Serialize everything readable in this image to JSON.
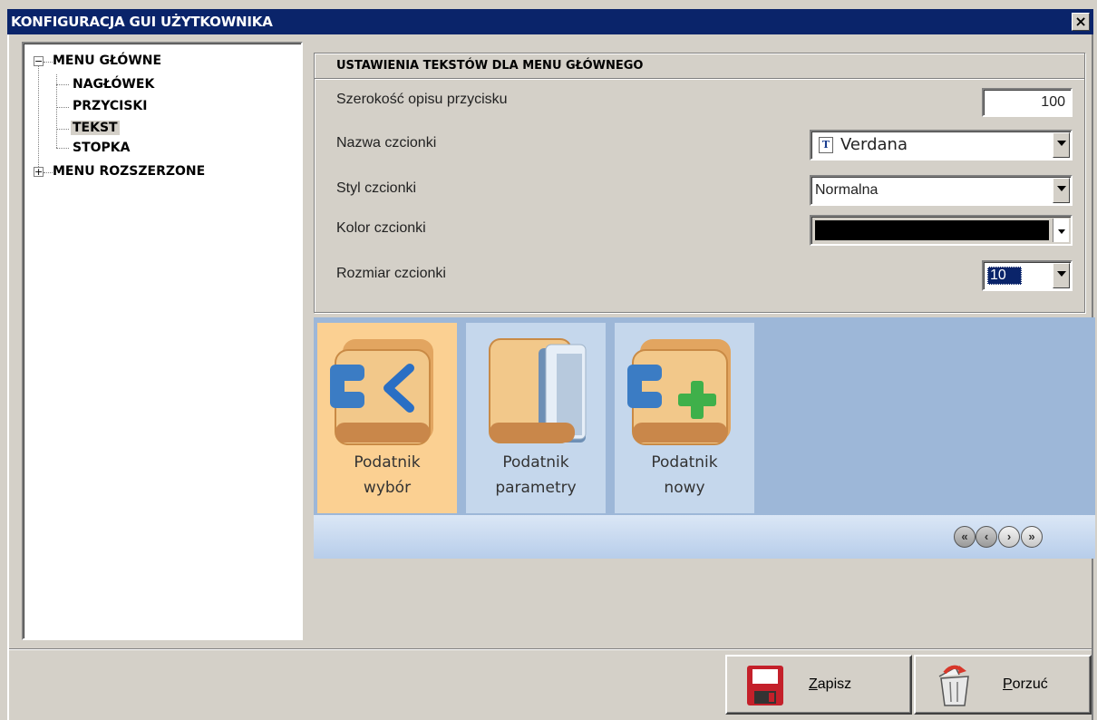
{
  "window": {
    "title": "KONFIGURACJA GUI UŻYTKOWNIKA",
    "close_glyph": "×"
  },
  "tree": {
    "root1": {
      "label": "MENU GŁÓWNE",
      "expander": "−"
    },
    "children": [
      "NAGŁÓWEK",
      "PRZYCISKI",
      "TEKST",
      "STOPKA"
    ],
    "selected": "TEKST",
    "root2": {
      "label": "MENU ROZSZERZONE",
      "expander": "+"
    }
  },
  "settings": {
    "title": "USTAWIENIA TEKSTÓW DLA MENU GŁÓWNEGO",
    "button_width": {
      "label": "Szerokość opisu przycisku",
      "value": "100"
    },
    "font_name": {
      "label": "Nazwa czcionki",
      "value": "Verdana",
      "icon": "truetype-font-icon"
    },
    "font_style": {
      "label": "Styl czcionki",
      "value": "Normalna"
    },
    "font_color": {
      "label": "Kolor czcionki",
      "value": "#000000"
    },
    "font_size": {
      "label": "Rozmiar czcionki",
      "value": "10"
    }
  },
  "preview": {
    "tiles": [
      {
        "line1": "Podatnik",
        "line2": "wybór",
        "icon": "folder-back-icon",
        "active": true
      },
      {
        "line1": "Podatnik",
        "line2": "parametry",
        "icon": "folder-open-icon",
        "active": false
      },
      {
        "line1": "Podatnik",
        "line2": "nowy",
        "icon": "folder-add-icon",
        "active": false
      }
    ],
    "nav": {
      "first": "«",
      "prev": "‹",
      "next": "›",
      "last": "»"
    }
  },
  "buttons": {
    "save": {
      "accel": "Z",
      "rest": "apisz",
      "icon": "floppy-disk-icon"
    },
    "discard": {
      "accel": "P",
      "rest": "orzuć",
      "icon": "trash-bin-icon"
    }
  },
  "colors": {
    "titlebar": "#0a246a",
    "strip": "#9db7d8",
    "tile_active": "#fbd092",
    "tile": "#c5d7ec"
  }
}
